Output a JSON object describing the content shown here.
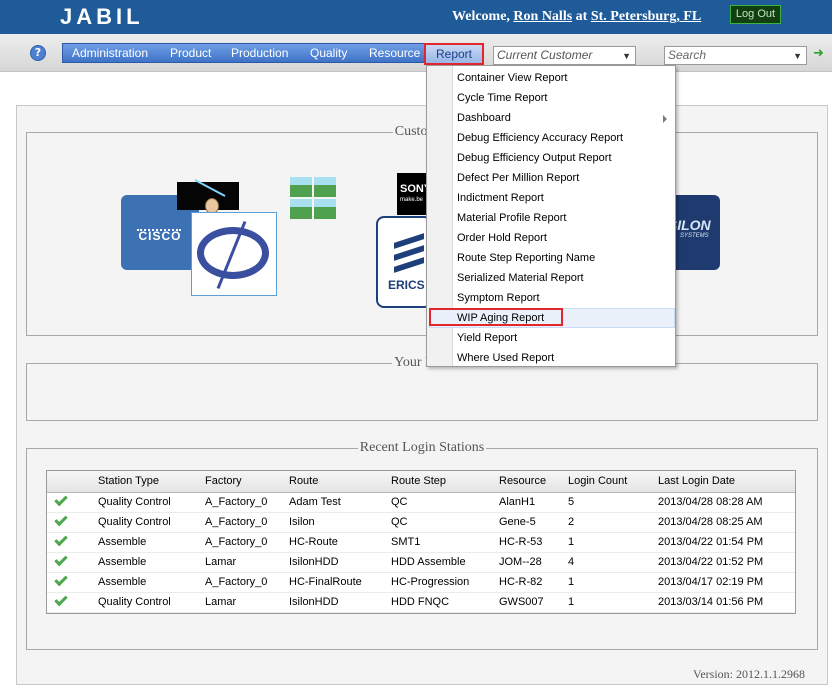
{
  "header": {
    "logo_text": "JABIL",
    "welcome_prefix": "Welcome,",
    "user_name": "Ron Nalls",
    "at_text": "at",
    "location": "St. Petersburg, FL",
    "logout_label": "Log Out"
  },
  "nav": {
    "help_label": "?",
    "menu": [
      "Administration",
      "Product",
      "Production",
      "Quality",
      "Resource",
      "Report"
    ],
    "customer_placeholder": "Current Customer",
    "search_placeholder": "Search"
  },
  "report_menu": {
    "items": [
      "Container View Report",
      "Cycle Time Report",
      "Dashboard",
      "Debug Efficiency Accuracy Report",
      "Debug Efficiency Output Report",
      "Defect Per Million Report",
      "Indictment Report",
      "Material Profile Report",
      "Order Hold Report",
      "Route Step Reporting Name",
      "Serialized Material Report",
      "Symptom Report",
      "WIP Aging Report",
      "Yield Report",
      "Where Used Report"
    ],
    "selected": "WIP Aging Report"
  },
  "sections": {
    "customer_title": "Customer",
    "notify_title": "Your Noti",
    "recent_title": "Recent Login Stations"
  },
  "logos": {
    "cisco": "CISCO",
    "sony": "SONY",
    "sony_sub": "make.be",
    "ericsson": "ERICS",
    "isilon": "ISILON",
    "isilon_sub": "SYSTEMS"
  },
  "stations": {
    "columns": [
      "",
      "Station Type",
      "Factory",
      "Route",
      "Route Step",
      "Resource",
      "Login Count",
      "Last Login Date"
    ],
    "rows": [
      [
        "Quality Control",
        "A_Factory_0",
        "Adam Test",
        "QC",
        "AlanH1",
        "5",
        "2013/04/28 08:28 AM"
      ],
      [
        "Quality Control",
        "A_Factory_0",
        "Isilon",
        "QC",
        "Gene-5",
        "2",
        "2013/04/28 08:25 AM"
      ],
      [
        "Assemble",
        "A_Factory_0",
        "HC-Route",
        "SMT1",
        "HC-R-53",
        "1",
        "2013/04/22 01:54 PM"
      ],
      [
        "Assemble",
        "Lamar",
        "IsilonHDD",
        "HDD Assemble",
        "JOM--28",
        "4",
        "2013/04/22 01:52 PM"
      ],
      [
        "Assemble",
        "A_Factory_0",
        "HC-FinalRoute",
        "HC-Progression",
        "HC-R-82",
        "1",
        "2013/04/17 02:19 PM"
      ],
      [
        "Quality Control",
        "Lamar",
        "IsilonHDD",
        "HDD FNQC",
        "GWS007",
        "1",
        "2013/03/14 01:56 PM"
      ]
    ]
  },
  "footer": {
    "version": "Version: 2012.1.1.2968"
  },
  "colors": {
    "header_bg": "#1f5b99",
    "menu_bg": "#4f83d6",
    "highlight": "#e2262c",
    "check": "#4aa84a"
  }
}
